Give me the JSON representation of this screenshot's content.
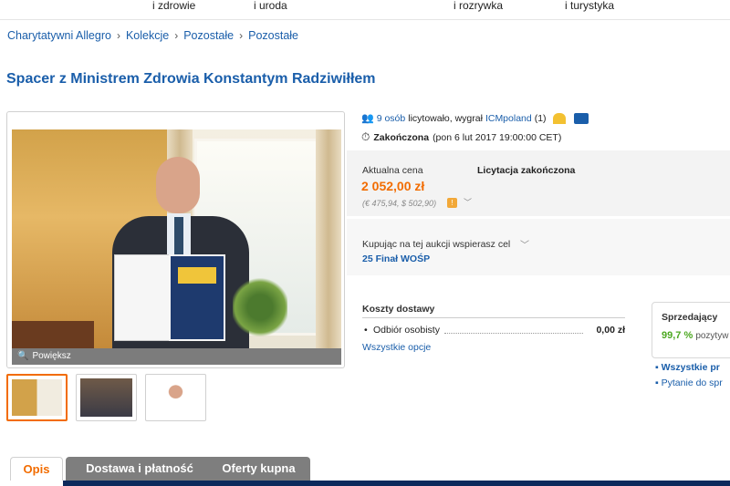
{
  "topnav": {
    "items": [
      "i zdrowie",
      "i uroda",
      "i rozrywka",
      "i turystyka"
    ]
  },
  "breadcrumb": [
    "Charytatywni Allegro",
    "Kolekcje",
    "Pozostałe",
    "Pozostałe"
  ],
  "title": "Spacer z Ministrem Zdrowia Konstantym Radziwiłłem",
  "gallery": {
    "zoom_label": "Powiększ",
    "zoom_icon": "magnifier-icon"
  },
  "bids": {
    "count_link": "9 osób",
    "text": "licytowało, wygrał",
    "winner": "ICMpoland",
    "winner_score": "(1)"
  },
  "ended": {
    "status": "Zakończona",
    "date": "(pon 6 lut 2017 19:00:00 CET)"
  },
  "price": {
    "label": "Aktualna cena",
    "status": "Licytacja zakończona",
    "value": "2 052,00 zł",
    "conversion": "(€ 475,94, $ 502,90)",
    "accent": "#f26c00"
  },
  "support": {
    "label": "Kupując na tej aukcji wspierasz cel",
    "cause": "25 Finał WOŚP"
  },
  "shipping": {
    "header": "Koszty dostawy",
    "options": [
      {
        "name": "Odbiór osobisty",
        "price": "0,00 zł"
      }
    ],
    "all_link": "Wszystkie opcje"
  },
  "seller": {
    "header": "Sprzedający",
    "percent": "99,7 %",
    "percent_suffix": "pozytyw",
    "links": [
      "Wszystkie pr",
      "Pytanie do spr"
    ]
  },
  "tabs": [
    "Opis",
    "Dostawa i płatność",
    "Oferty kupna"
  ]
}
